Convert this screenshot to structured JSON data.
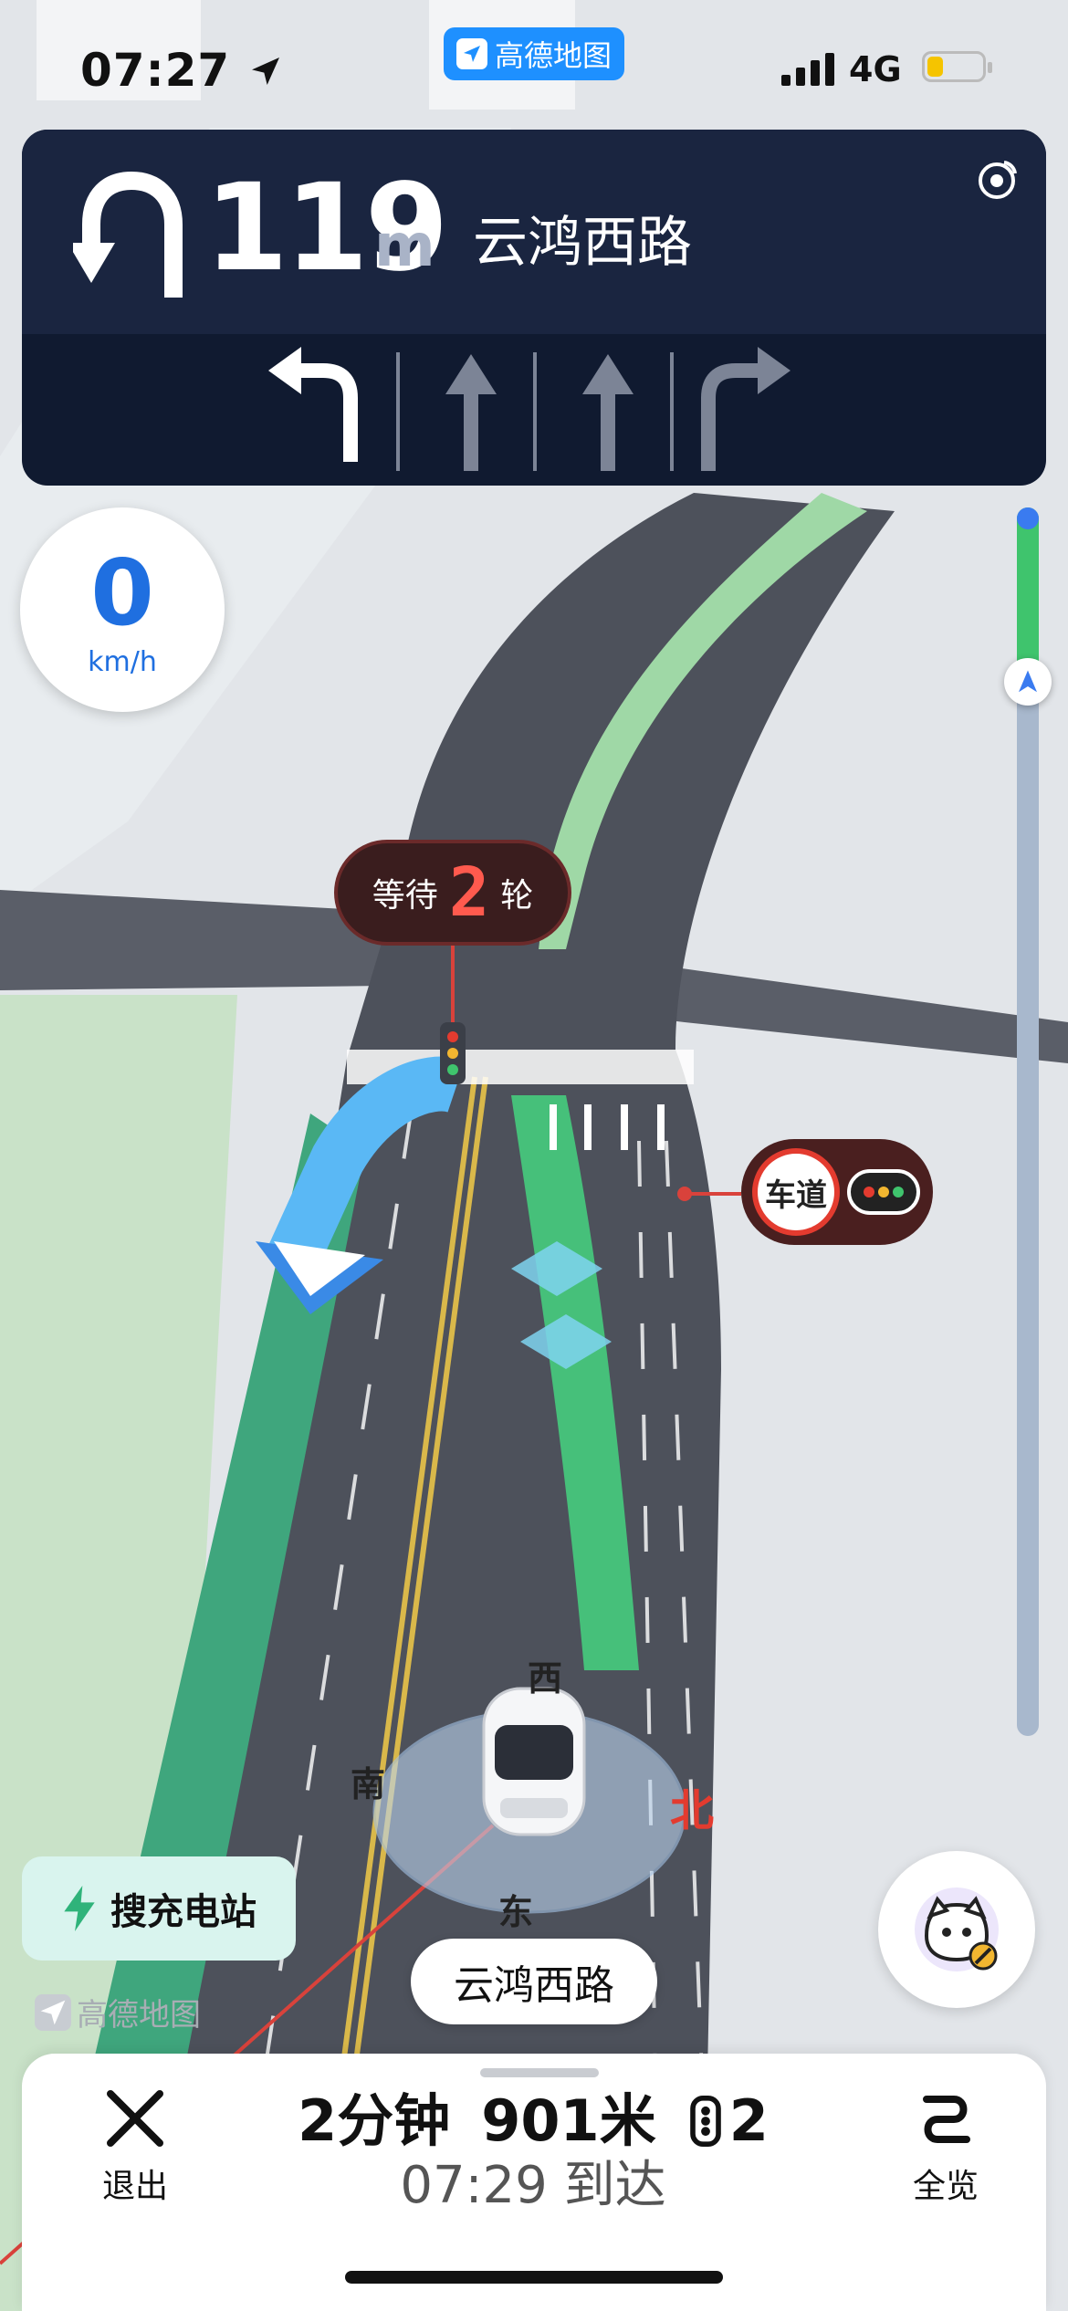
{
  "status_bar": {
    "time": "07:27",
    "app_badge": "高德地图",
    "network": "4G",
    "battery_level": 0.3
  },
  "guidance": {
    "maneuver_icon": "u-turn-left-icon",
    "distance": "119",
    "distance_unit": "m",
    "road_name": "云鸿西路",
    "gps_icon": "gps-signal-icon",
    "lanes": [
      {
        "icon": "lane-turn-left-icon",
        "active": true
      },
      {
        "icon": "lane-straight-icon",
        "active": false
      },
      {
        "icon": "lane-straight-icon",
        "active": false
      },
      {
        "icon": "lane-turn-right-icon",
        "active": false
      }
    ]
  },
  "speed": {
    "value": "0",
    "unit": "km/h"
  },
  "route_progress": {
    "fraction_complete": 0.13
  },
  "traffic_light": {
    "wait_label": "等待",
    "wait_count": "2",
    "wait_unit": "轮"
  },
  "lane_light_badge": {
    "label": "车道"
  },
  "compass": {
    "north": "北",
    "south": "南",
    "east": "东",
    "west": "西"
  },
  "buttons": {
    "charge_station": "搜充电站",
    "exit": "退出",
    "overview": "全览"
  },
  "watermark": "高德地图",
  "current_road": "云鸿西路",
  "trip": {
    "duration": "2分钟",
    "distance": "901米",
    "traffic_lights": "2",
    "arrival": "07:29 到达"
  },
  "colors": {
    "guide_panel": "#101a30",
    "speed_blue": "#1f6fe0",
    "route_green": "#3fc46d",
    "alert_red": "#e33b2f",
    "charge_btn_bg": "#d9f4ee"
  }
}
